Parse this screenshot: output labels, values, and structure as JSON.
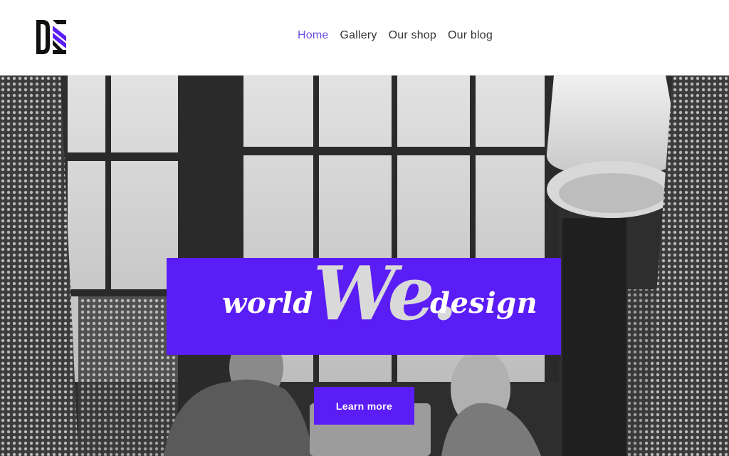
{
  "header": {
    "nav": [
      {
        "label": "Home",
        "active": true
      },
      {
        "label": "Gallery",
        "active": false
      },
      {
        "label": "Our shop",
        "active": false
      },
      {
        "label": "Our blog",
        "active": false
      }
    ]
  },
  "hero": {
    "word_left": "world",
    "word_center": "We.",
    "word_right": "design",
    "cta_label": "Learn more"
  },
  "colors": {
    "accent": "#5b1df5",
    "nav_active": "#6c4ee6",
    "logo_dark": "#111111"
  }
}
